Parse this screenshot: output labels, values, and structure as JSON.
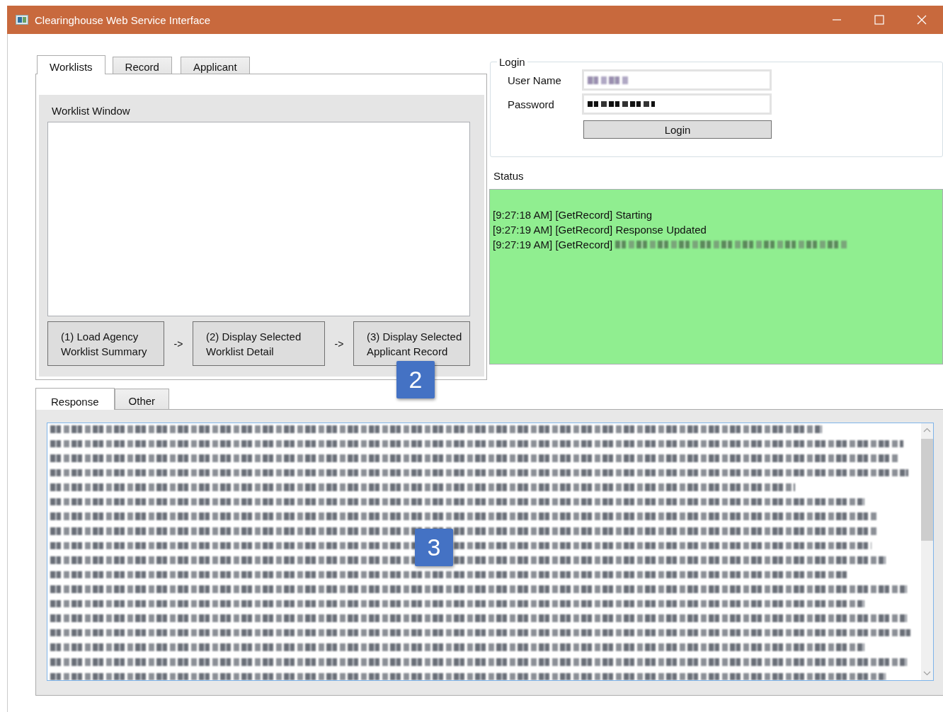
{
  "window": {
    "title": "Clearinghouse Web Service Interface"
  },
  "tabs": [
    {
      "label": "Worklists",
      "selected": true
    },
    {
      "label": "Record",
      "selected": false
    },
    {
      "label": "Applicant",
      "selected": false
    }
  ],
  "worklist": {
    "label": "Worklist Window",
    "steps": [
      {
        "lines": [
          "(1) Load Agency",
          "Worklist Summary"
        ]
      },
      {
        "lines": [
          "(2) Display Selected",
          "Worklist Detail"
        ]
      },
      {
        "lines": [
          "(3) Display Selected",
          "Applicant Record"
        ]
      }
    ],
    "arrows": [
      "->",
      "->"
    ]
  },
  "login": {
    "legend": "Login",
    "fields": [
      {
        "label": "User Name",
        "kind": "text"
      },
      {
        "label": "Password",
        "kind": "password"
      }
    ],
    "button": "Login"
  },
  "status": {
    "label": "Status",
    "lines": [
      {
        "text": "[9:27:18 AM] [GetRecord] Starting",
        "redacted": false
      },
      {
        "text": "[9:27:19 AM] [GetRecord] Response Updated",
        "redacted": false
      },
      {
        "text": "[9:27:19 AM] [GetRecord]",
        "redacted": true
      }
    ]
  },
  "bottom_tabs": [
    {
      "label": "Response",
      "selected": true
    },
    {
      "label": "Other",
      "selected": false
    }
  ],
  "badges": [
    {
      "text": "2"
    },
    {
      "text": "3"
    }
  ]
}
